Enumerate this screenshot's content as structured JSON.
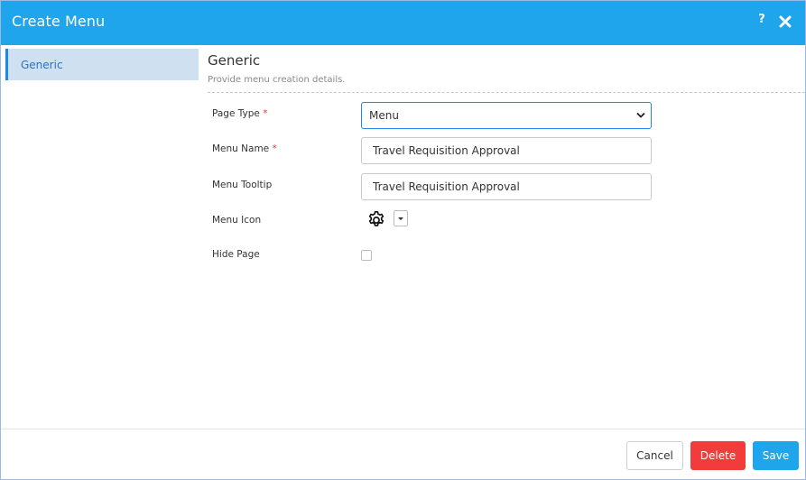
{
  "dialog": {
    "title": "Create Menu",
    "help_label": "?",
    "close_icon": "close-icon"
  },
  "sidebar": {
    "items": [
      {
        "label": "Generic",
        "active": true
      }
    ]
  },
  "section": {
    "title": "Generic",
    "subtitle": "Provide menu creation details."
  },
  "form": {
    "page_type": {
      "label": "Page Type",
      "required_mark": "*",
      "value": "Menu"
    },
    "menu_name": {
      "label": "Menu Name",
      "required_mark": "*",
      "value": "Travel Requisition Approval"
    },
    "menu_tooltip": {
      "label": "Menu Tooltip",
      "value": "Travel Requisition Approval"
    },
    "menu_icon": {
      "label": "Menu Icon",
      "icon": "gear-icon"
    },
    "hide_page": {
      "label": "Hide Page",
      "checked": false
    }
  },
  "footer": {
    "cancel_label": "Cancel",
    "delete_label": "Delete",
    "save_label": "Save"
  },
  "colors": {
    "header": "#1ea5ec",
    "delete": "#f23c3c",
    "save": "#1ea5ec",
    "active_item_bg": "#cfe0f1",
    "active_item_text": "#2a73c5"
  }
}
